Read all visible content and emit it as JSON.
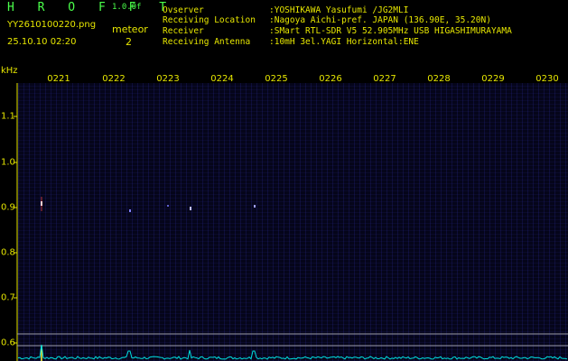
{
  "header": {
    "app_name": "H R O F F T",
    "version": "1.0.0f",
    "filename": "YY2610100220.png",
    "datetime": "25.10.10 02:20",
    "meteor_label": "meteor",
    "meteor_count": "2"
  },
  "info": [
    {
      "key": "Ovserver",
      "value": ":YOSHIKAWA Yasufumi /JG2MLI"
    },
    {
      "key": "Receiving Location",
      "value": ":Nagoya Aichi-pref. JAPAN (136.90E, 35.20N)"
    },
    {
      "key": "Receiver",
      "value": ":SMart RTL-SDR V5 52.905MHz USB HIGASHIMURAYAMA"
    },
    {
      "key": "Receiving Antenna",
      "value": ":10mH 3el.YAGI Horizontal:ENE"
    }
  ],
  "axis": {
    "y_unit": "kHz",
    "y_ticks": [
      "1.1",
      "1.0",
      "0.9",
      "0.8",
      "0.7",
      "0.6"
    ],
    "x_ticks": [
      "0221",
      "0222",
      "0223",
      "0224",
      "0225",
      "0226",
      "0227",
      "0228",
      "0229",
      "0230"
    ]
  },
  "colors": {
    "text": "#e6e600",
    "title": "#4aff4a",
    "grid": "#9a9aa8",
    "trace": "#00e0e0",
    "plot_bg": "#05051a"
  }
}
